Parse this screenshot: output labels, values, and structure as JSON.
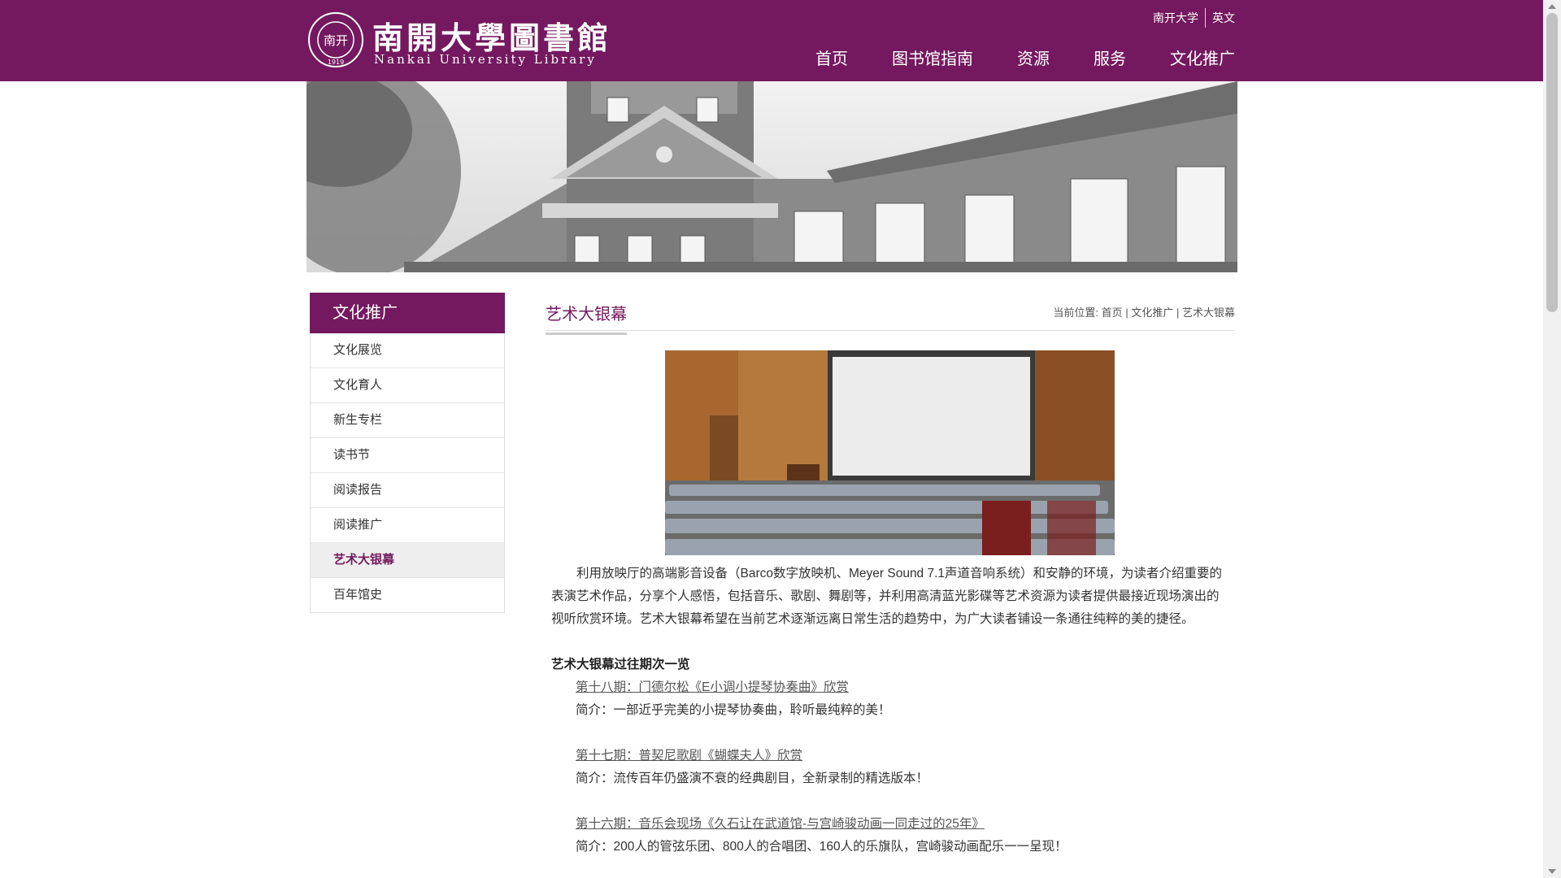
{
  "header": {
    "logo_cn": "南開大學圖書館",
    "logo_en": "Nankai University Library",
    "seal_text": "南开",
    "seal_year": "1919",
    "toplinks": [
      "南开大学",
      "英文"
    ],
    "nav": [
      "首页",
      "图书馆指南",
      "资源",
      "服务",
      "文化推广"
    ]
  },
  "sidebar": {
    "title": "文化推广",
    "items": [
      {
        "label": "文化展览"
      },
      {
        "label": "文化育人"
      },
      {
        "label": "新生专栏"
      },
      {
        "label": "读书节"
      },
      {
        "label": "阅读报告"
      },
      {
        "label": "阅读推广"
      },
      {
        "label": "艺术大银幕",
        "active": true
      },
      {
        "label": "百年馆史"
      }
    ]
  },
  "main": {
    "title": "艺术大银幕",
    "breadcrumb": {
      "prefix": "当前位置:",
      "items": [
        "首页",
        "文化推广",
        "艺术大银幕"
      ],
      "sep": "|"
    },
    "intro": "利用放映厅的高端影音设备（Barco数字放映机、Meyer Sound 7.1声道音响系统）和安静的环境，为读者介绍重要的表演艺术作品，分享个人感悟，包括音乐、歌剧、舞剧等，并利用高清蓝光影碟等艺术资源为读者提供最接近现场演出的视听欣赏环境。艺术大银幕希望在当前艺术逐渐远离日常生活的趋势中，为广大读者铺设一条通往纯粹的美的捷径。",
    "list_title": "艺术大银幕过往期次一览",
    "entries": [
      {
        "link": "第十八期：门德尔松《E小调小提琴协奏曲》欣赏",
        "desc": "简介：一部近乎完美的小提琴协奏曲，聆听最纯粹的美！"
      },
      {
        "link": "第十七期：普契尼歌剧《蝴蝶夫人》欣赏",
        "desc": "简介：流传百年仍盛演不衰的经典剧目，全新录制的精选版本！"
      },
      {
        "link": "第十六期：音乐会现场《久石让在武道馆-与宫崎骏动画一同走过的25年》",
        "desc": "简介：200人的管弦乐团、800人的合唱团、160人的乐旗队，宫崎骏动画配乐一一呈现！"
      }
    ]
  },
  "colors": {
    "brand": "#74195f",
    "active_bg": "#eeeeee"
  }
}
